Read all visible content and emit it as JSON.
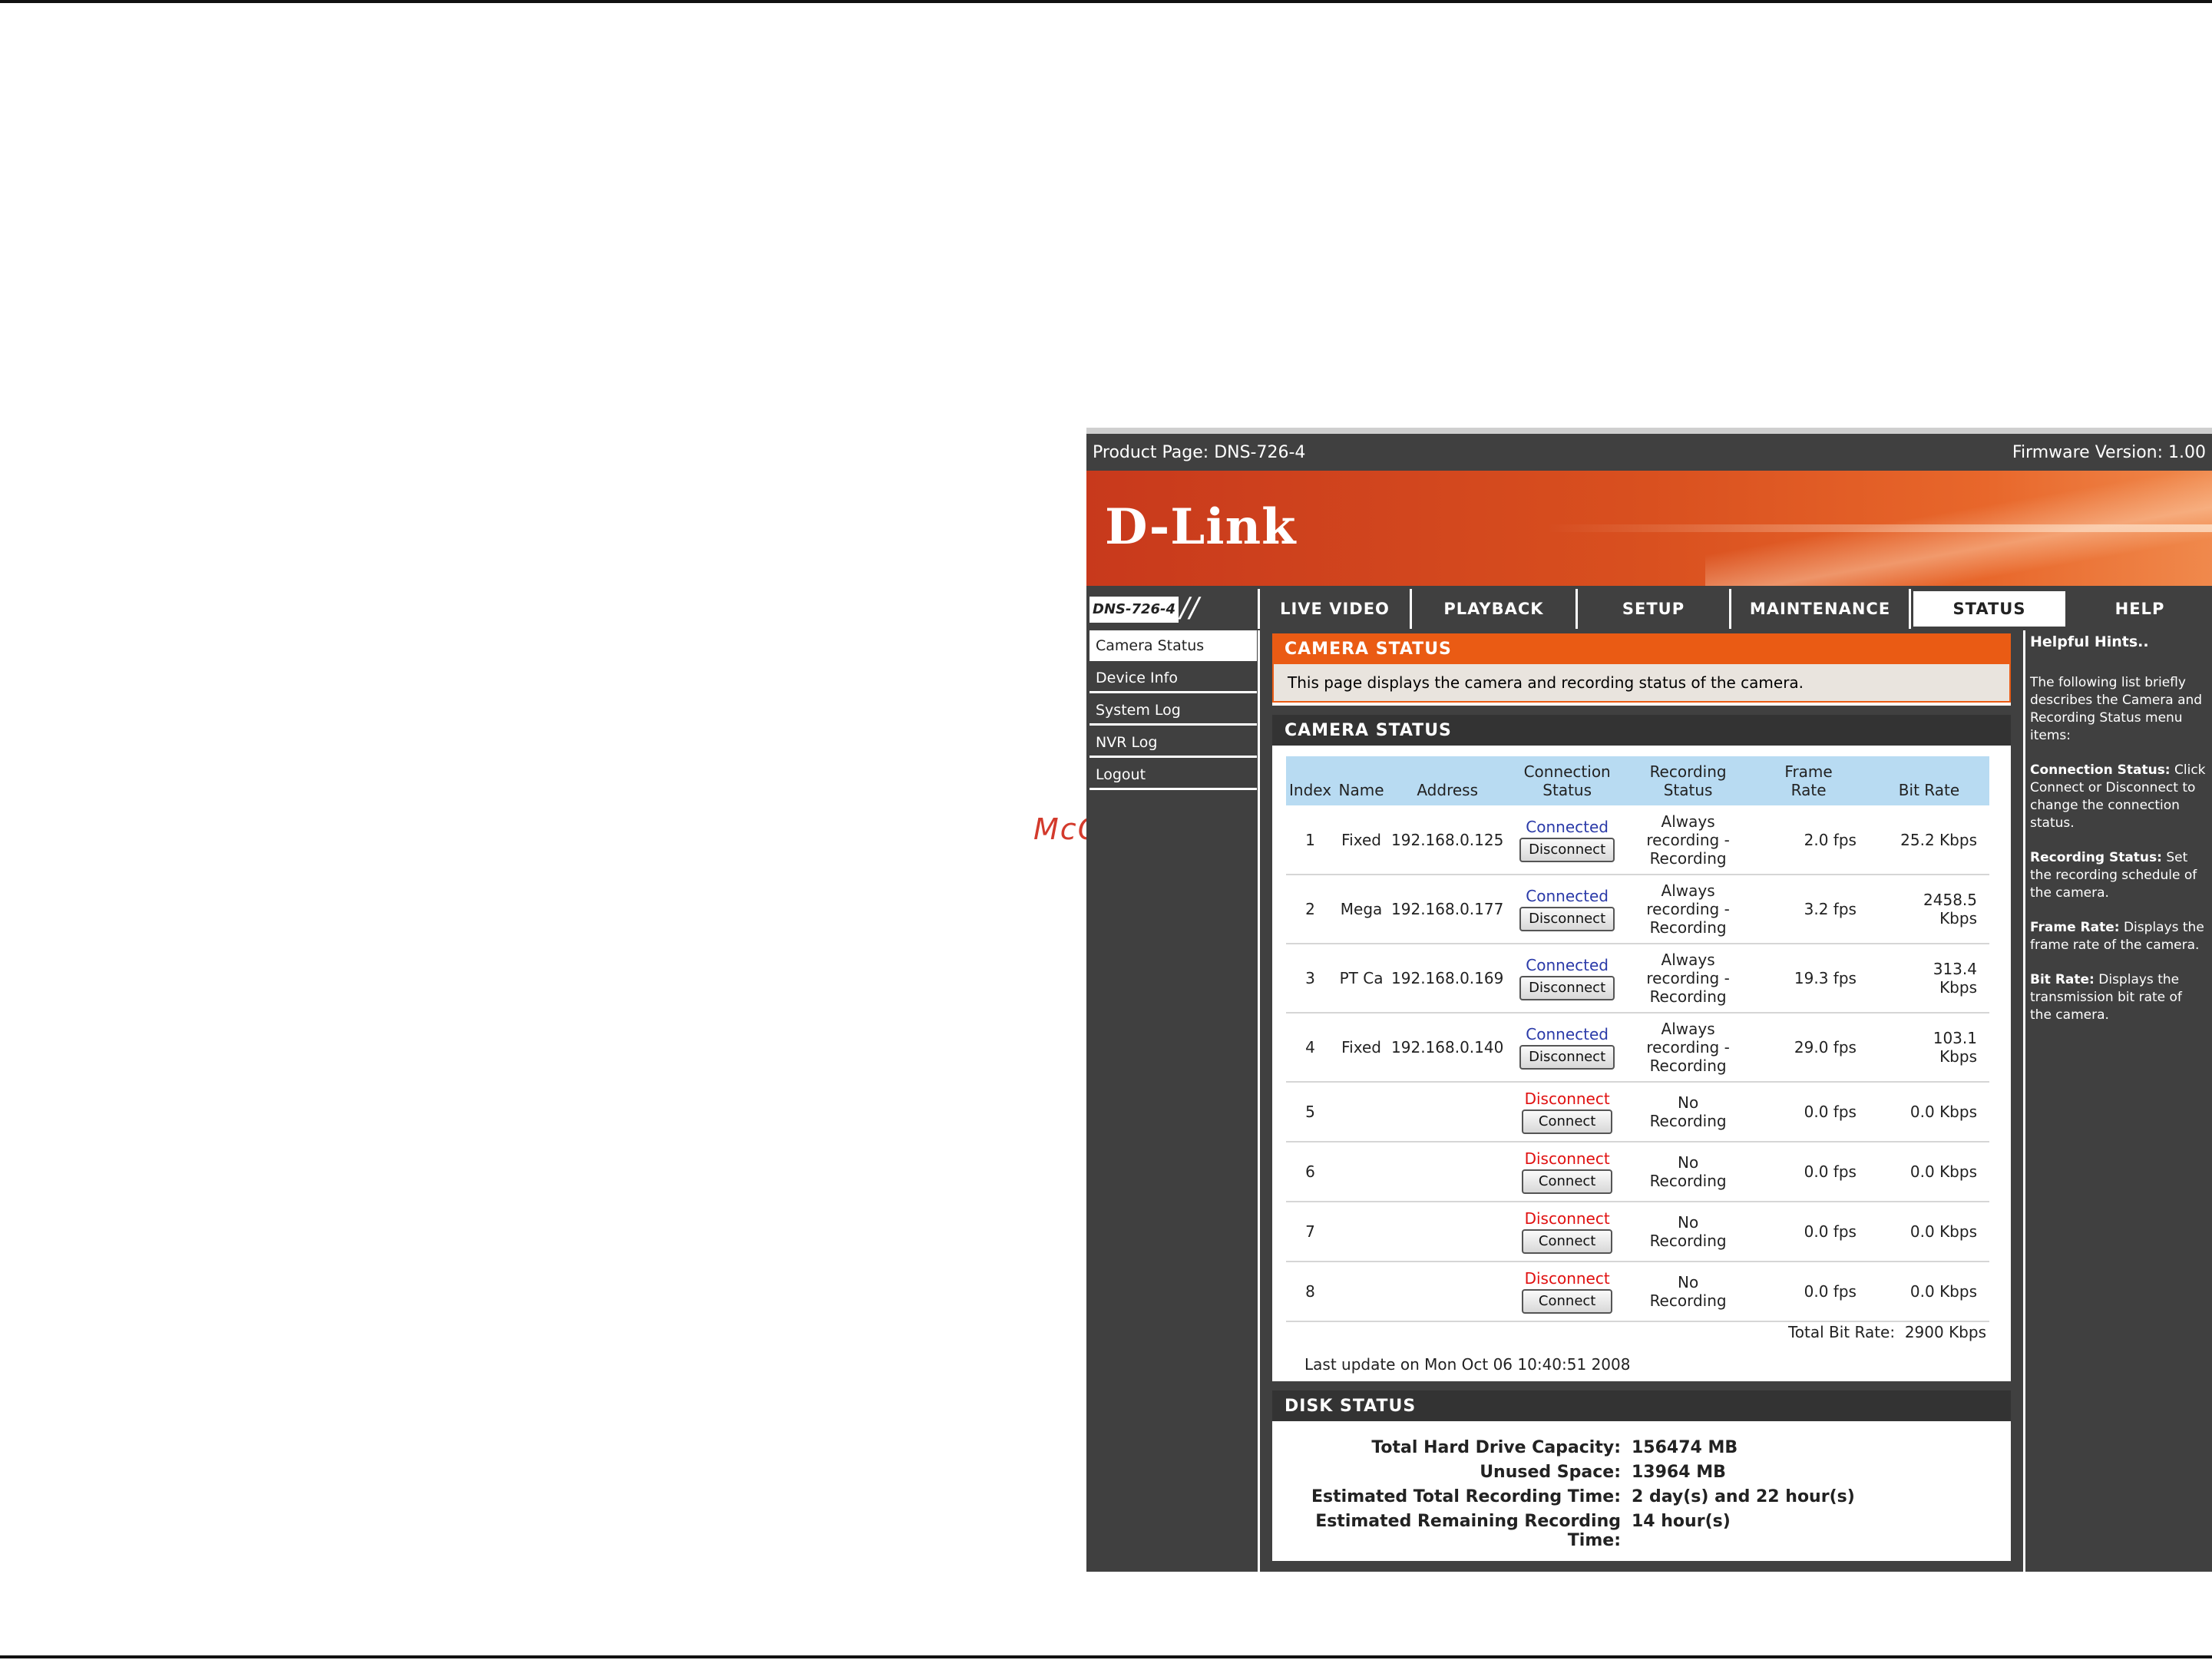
{
  "watermark": "McGrp.Ru",
  "header": {
    "product_page": "Product Page: DNS-726-4",
    "firmware": "Firmware Version: 1.00"
  },
  "brand": {
    "logo": "D-Link",
    "model": "DNS-726-4"
  },
  "nav": {
    "tabs": [
      {
        "label": "LIVE VIDEO"
      },
      {
        "label": "PLAYBACK"
      },
      {
        "label": "SETUP"
      },
      {
        "label": "MAINTENANCE"
      },
      {
        "label": "STATUS"
      },
      {
        "label": "HELP"
      }
    ],
    "active": "STATUS"
  },
  "sidebar": {
    "items": [
      {
        "label": "Camera Status"
      },
      {
        "label": "Device Info"
      },
      {
        "label": "System Log"
      },
      {
        "label": "NVR Log"
      },
      {
        "label": "Logout"
      }
    ]
  },
  "intro": {
    "title": "CAMERA STATUS",
    "text": "This page displays the camera and recording status of the camera."
  },
  "camera_status": {
    "title": "CAMERA STATUS",
    "columns": {
      "index": "Index",
      "name": "Name",
      "address": "Address",
      "conn_1": "Connection",
      "conn_2": "Status",
      "rec_1": "Recording",
      "rec_2": "Status",
      "fr_1": "Frame",
      "fr_2": "Rate",
      "bitrate": "Bit Rate"
    },
    "rows": [
      {
        "index": "1",
        "name": "Fixed",
        "address": "192.168.0.125",
        "status": "Connected",
        "button": "Disconnect",
        "rec1": "Always",
        "rec2": "recording -",
        "rec3": "Recording",
        "fps": "2.0 fps",
        "br1": "25.2 Kbps",
        "br2": ""
      },
      {
        "index": "2",
        "name": "Mega",
        "address": "192.168.0.177",
        "status": "Connected",
        "button": "Disconnect",
        "rec1": "Always",
        "rec2": "recording -",
        "rec3": "Recording",
        "fps": "3.2 fps",
        "br1": "2458.5",
        "br2": "Kbps"
      },
      {
        "index": "3",
        "name": "PT Ca",
        "address": "192.168.0.169",
        "status": "Connected",
        "button": "Disconnect",
        "rec1": "Always",
        "rec2": "recording -",
        "rec3": "Recording",
        "fps": "19.3 fps",
        "br1": "313.4",
        "br2": "Kbps"
      },
      {
        "index": "4",
        "name": "Fixed",
        "address": "192.168.0.140",
        "status": "Connected",
        "button": "Disconnect",
        "rec1": "Always",
        "rec2": "recording -",
        "rec3": "Recording",
        "fps": "29.0 fps",
        "br1": "103.1",
        "br2": "Kbps"
      },
      {
        "index": "5",
        "name": "",
        "address": "",
        "status": "Disconnect",
        "button": "Connect",
        "rec1": "No",
        "rec2": "Recording",
        "rec3": "",
        "fps": "0.0 fps",
        "br1": "0.0 Kbps",
        "br2": ""
      },
      {
        "index": "6",
        "name": "",
        "address": "",
        "status": "Disconnect",
        "button": "Connect",
        "rec1": "No",
        "rec2": "Recording",
        "rec3": "",
        "fps": "0.0 fps",
        "br1": "0.0 Kbps",
        "br2": ""
      },
      {
        "index": "7",
        "name": "",
        "address": "",
        "status": "Disconnect",
        "button": "Connect",
        "rec1": "No",
        "rec2": "Recording",
        "rec3": "",
        "fps": "0.0 fps",
        "br1": "0.0 Kbps",
        "br2": ""
      },
      {
        "index": "8",
        "name": "",
        "address": "",
        "status": "Disconnect",
        "button": "Connect",
        "rec1": "No",
        "rec2": "Recording",
        "rec3": "",
        "fps": "0.0 fps",
        "br1": "0.0 Kbps",
        "br2": ""
      }
    ],
    "total_label": "Total Bit Rate:",
    "total_value": "2900 Kbps",
    "last_update": "Last update on Mon Oct 06 10:40:51 2008"
  },
  "disk_status": {
    "title": "DISK STATUS",
    "rows": [
      {
        "label": "Total Hard Drive Capacity:",
        "value": "156474 MB"
      },
      {
        "label": "Unused Space:",
        "value": "13964 MB"
      },
      {
        "label": "Estimated Total Recording Time:",
        "value": "2 day(s) and 22 hour(s)"
      },
      {
        "label": "Estimated Remaining Recording Time:",
        "value": "14 hour(s)"
      }
    ]
  },
  "hints": {
    "title": "Helpful Hints..",
    "intro": "The following list briefly describes the Camera and Recording Status menu items:",
    "items": [
      {
        "term": "Connection Status:",
        "text": "Click Connect or Disconnect to change the connection status."
      },
      {
        "term": "Recording Status:",
        "text": "Set the recording schedule of the camera."
      },
      {
        "term": "Frame Rate:",
        "text": "Displays the frame rate of the camera."
      },
      {
        "term": "Bit Rate:",
        "text": "Displays the transmission bit rate of the camera."
      }
    ]
  }
}
